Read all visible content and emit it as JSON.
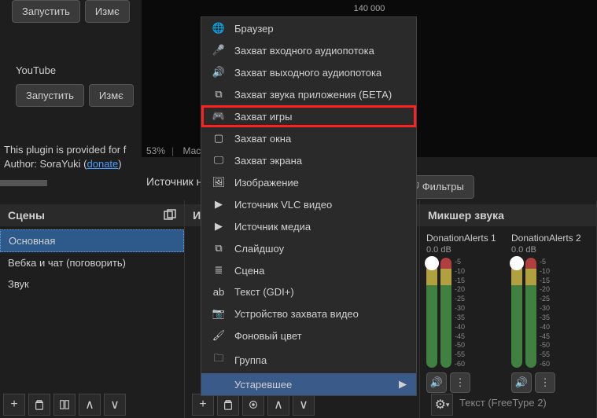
{
  "top": {
    "launch": "Запустить",
    "change": "Измє",
    "youtube": "YouTube",
    "yt_launch": "Запустить",
    "yt_change": "Измє",
    "plugin_line1": "This plugin is provided for f",
    "plugin_line2": "Author: SoraYuki (",
    "donate": "donate",
    "plugin_line2_end": ")"
  },
  "preview": {
    "label": "140 000"
  },
  "status": {
    "pct": "53%",
    "scale": "Масш"
  },
  "source_panel_label": "Источник н",
  "filters": "Фильтры",
  "panels": {
    "scenes": {
      "title": "Сцены",
      "items": [
        "Основная",
        "Вебка и чат (поговорить)",
        "Звук"
      ]
    },
    "sources": {
      "title": "И"
    },
    "mixer": {
      "title": "Микшер звука",
      "channels": [
        {
          "name": "DonationAlerts 1",
          "db": "0.0 dB"
        },
        {
          "name": "DonationAlerts 2",
          "db": "0.0 dB"
        }
      ],
      "scale": [
        "-5",
        "-10",
        "-15",
        "-20",
        "-25",
        "-30",
        "-35",
        "-40",
        "-45",
        "-50",
        "-55",
        "-60"
      ],
      "hidden_text": "Текст (FreeType 2)"
    }
  },
  "menu": {
    "items": [
      {
        "icon": "globe",
        "label": "Браузер"
      },
      {
        "icon": "mic",
        "label": "Захват входного аудиопотока"
      },
      {
        "icon": "speaker",
        "label": "Захват выходного аудиопотока"
      },
      {
        "icon": "app",
        "label": "Захват звука приложения (БЕТА)"
      },
      {
        "icon": "gamepad",
        "label": "Захват игры",
        "highlighted": true
      },
      {
        "icon": "window",
        "label": "Захват окна"
      },
      {
        "icon": "screen",
        "label": "Захват экрана"
      },
      {
        "icon": "image",
        "label": "Изображение"
      },
      {
        "icon": "play",
        "label": "Источник VLC видео"
      },
      {
        "icon": "play",
        "label": "Источник медиа"
      },
      {
        "icon": "slides",
        "label": "Слайдшоу"
      },
      {
        "icon": "scene",
        "label": "Сцена"
      },
      {
        "icon": "text",
        "label": "Текст (GDI+)"
      },
      {
        "icon": "camera",
        "label": "Устройство захвата видео"
      },
      {
        "icon": "brush",
        "label": "Фоновый цвет"
      },
      {
        "icon": "folder",
        "label": "Группа"
      },
      {
        "icon": "",
        "label": "Устаревшее",
        "submenu": true
      }
    ]
  },
  "icons": {
    "globe": "🌐",
    "mic": "🎤",
    "speaker": "🔊",
    "app": "⧉",
    "gamepad": "🎮",
    "window": "▢",
    "screen": "🖵",
    "image": "🖼",
    "play": "▶",
    "slides": "⧉",
    "scene": "≣",
    "text": "ab",
    "camera": "📷",
    "brush": "🖌",
    "folder": "🗀"
  }
}
